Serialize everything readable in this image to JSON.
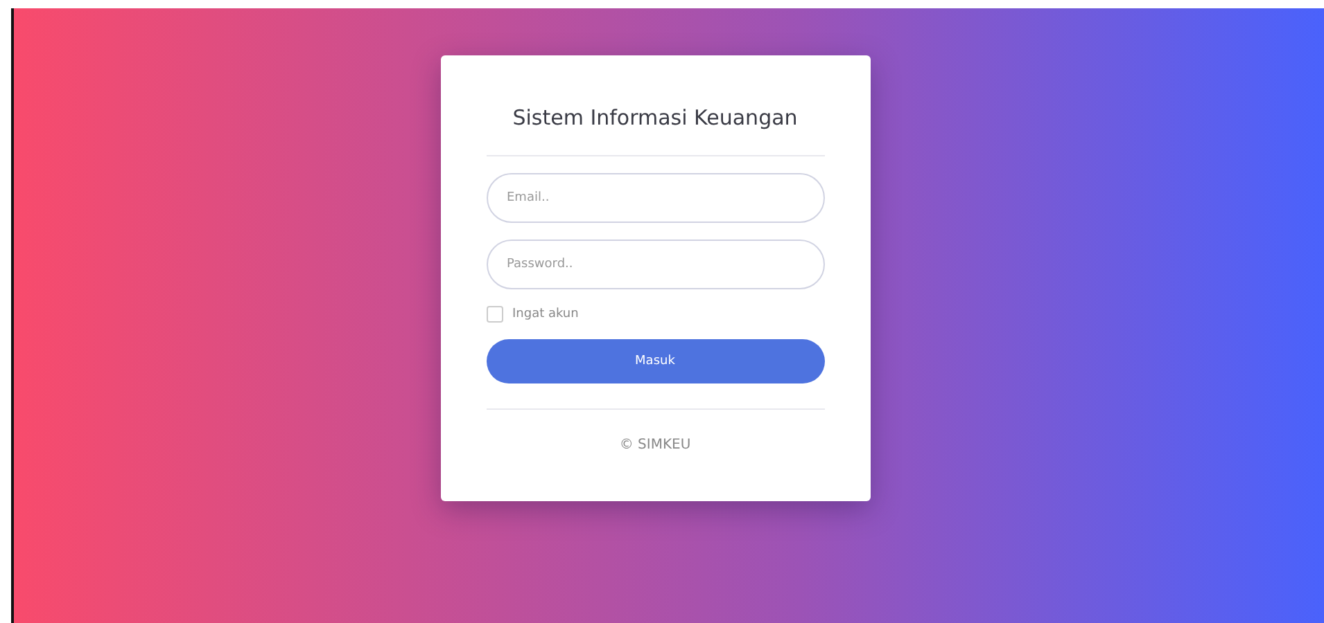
{
  "card": {
    "title": "Sistem Informasi Keuangan",
    "fields": [
      {
        "placeholder": "Email.."
      },
      {
        "placeholder": "Password.."
      }
    ],
    "remember": {
      "label": "Ingat akun",
      "checked": false
    },
    "submit": "Masuk",
    "footer": "© SIMKEU"
  }
}
